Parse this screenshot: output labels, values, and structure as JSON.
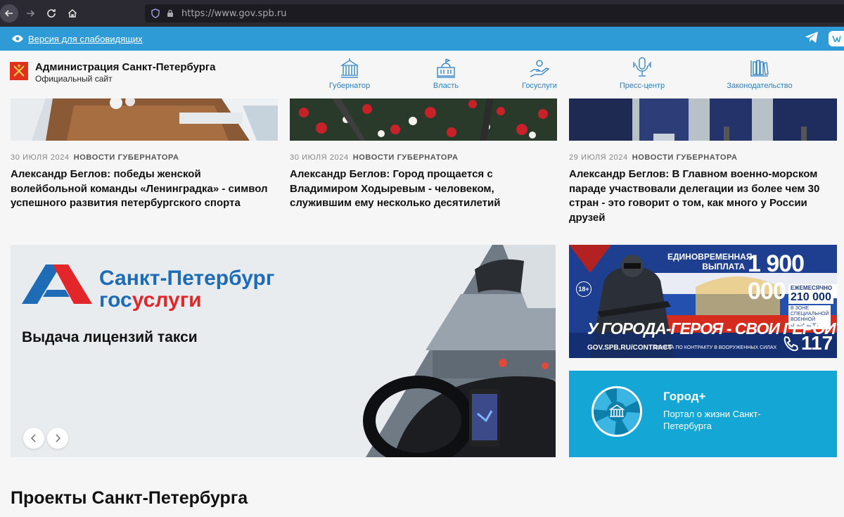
{
  "browser": {
    "url": "https://www.gov.spb.ru"
  },
  "access_bar": {
    "link": "Версия для слабовидящих"
  },
  "header": {
    "title": "Администрация Санкт-Петербурга",
    "subtitle": "Официальный сайт",
    "nav": [
      {
        "label": "Губернатор",
        "icon": "governor-building-icon"
      },
      {
        "label": "Власть",
        "icon": "government-building-icon"
      },
      {
        "label": "Госуслуги",
        "icon": "hand-service-icon"
      },
      {
        "label": "Пресс-центр",
        "icon": "microphone-icon"
      },
      {
        "label": "Законодательство",
        "icon": "law-books-icon"
      }
    ]
  },
  "news": [
    {
      "date": "30 ИЮЛЯ 2024",
      "category": "НОВОСТИ ГУБЕРНАТОРА",
      "title": "Александр Беглов: победы женской волейбольной команды «Ленинградка» - символ успешного развития петербургского спорта"
    },
    {
      "date": "30 ИЮЛЯ 2024",
      "category": "НОВОСТИ ГУБЕРНАТОРА",
      "title": "Александр Беглов: Город прощается с Владимиром Ходыревым - человеком, служившим ему несколько десятилетий"
    },
    {
      "date": "29 ИЮЛЯ 2024",
      "category": "НОВОСТИ ГУБЕРНАТОРА",
      "title": "Александр Беглов: В Главном военно-морском параде участвовали делегации из более чем 30 стран - это говорит о том, как много у России друзей"
    }
  ],
  "banner": {
    "brand_line1": "Санкт-Петербург",
    "brand_line2_a": "гос",
    "brand_line2_b": "услуги",
    "caption": "Выдача лицензий такси"
  },
  "ad_contract": {
    "top": "ЕДИНОВРЕМЕННАЯ ВЫПЛАТА",
    "amount": "1 900 000",
    "monthly_label": "ЕЖЕМЕСЯЧНО ОТ",
    "monthly_amount": "210 000",
    "zone": "В ЗОНЕ СПЕЦИАЛЬНОЙ ВОЕННОЙ ОПЕРАЦИИ",
    "age": "18+",
    "slogan": "У ГОРОДА-ГЕРОЯ - СВОИ ГЕРОИ",
    "url": "GOV.SPB.RU/CONTRACT",
    "service": "СЛУЖБА ПО КОНТРАКТУ В ВООРУЖЕННЫХ СИЛАХ",
    "phone": "117"
  },
  "ad_gorod": {
    "title": "Город+",
    "subtitle": "Портал о жизни Санкт-Петербурга"
  },
  "section": {
    "title": "Проекты Санкт-Петербурга"
  }
}
